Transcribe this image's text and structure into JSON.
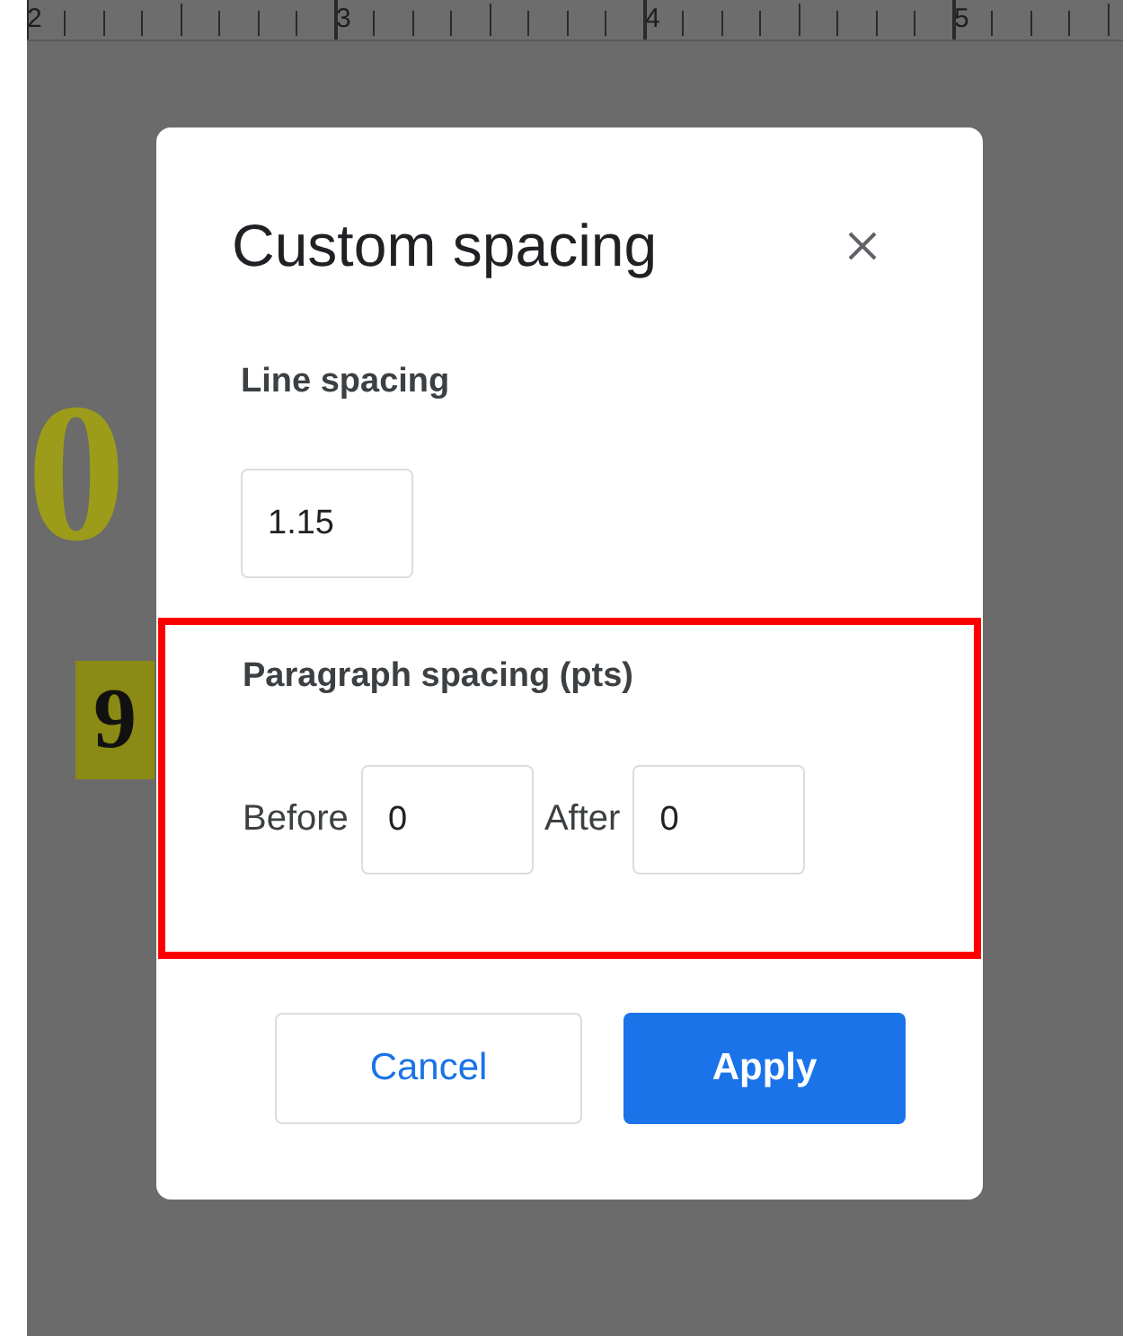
{
  "ruler": {
    "labels": [
      "2",
      "3",
      "4",
      "5"
    ]
  },
  "document": {
    "texts": [
      {
        "text": "0",
        "highlighted": false
      },
      {
        "text": "9",
        "highlighted": true
      }
    ]
  },
  "dialog": {
    "title": "Custom spacing",
    "line_spacing": {
      "label": "Line spacing",
      "value": "1.15"
    },
    "paragraph_spacing": {
      "highlighted": true,
      "label": "Paragraph spacing (pts)",
      "fields": [
        {
          "label": "Before",
          "value": "0"
        },
        {
          "label": "After",
          "value": "0"
        }
      ]
    },
    "buttons": [
      {
        "label": "Cancel",
        "kind": "secondary"
      },
      {
        "label": "Apply",
        "kind": "primary"
      }
    ]
  }
}
